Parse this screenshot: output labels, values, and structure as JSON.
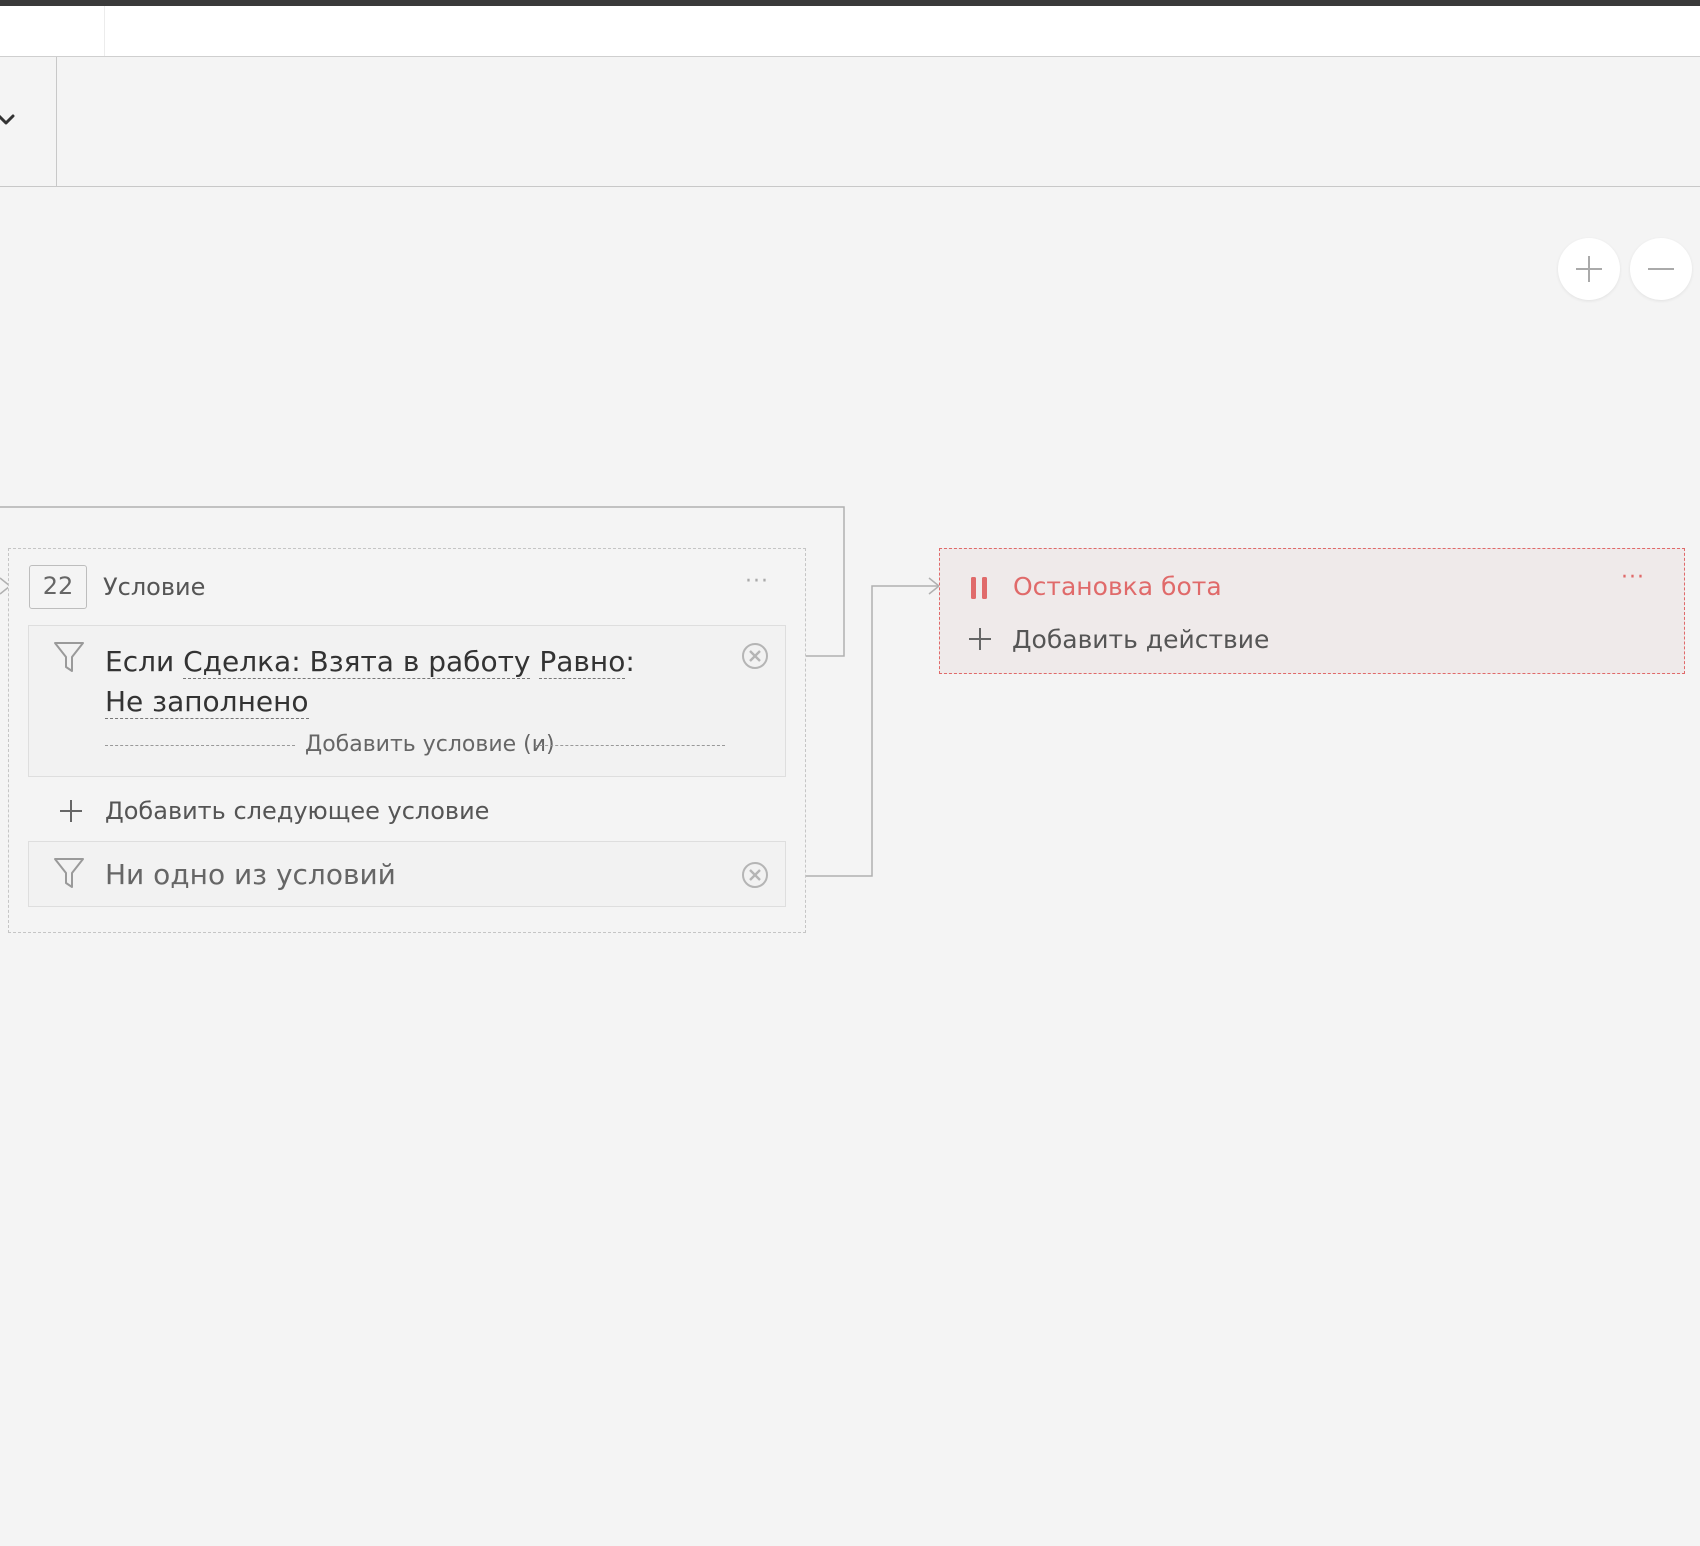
{
  "condition_block": {
    "number": "22",
    "title": "Условие",
    "condition1": {
      "prefix": "Если ",
      "field": "Сделка: Взята в работу",
      "operator": "Равно",
      "colon": ":",
      "value": "Не заполнено",
      "add_and_label": "Добавить условие (и)"
    },
    "add_next_label": "Добавить следующее условие",
    "none_label": "Ни одно из условий"
  },
  "stop_block": {
    "title": "Остановка бота",
    "add_action_label": "Добавить действие"
  },
  "icons": {
    "zoom_in": "plus-icon",
    "zoom_out": "minus-icon",
    "filter": "funnel-icon",
    "remove": "remove-circle-x-icon",
    "pause": "pause-icon",
    "more": "ellipsis-icon",
    "dropdown": "chevron-down-icon"
  },
  "colors": {
    "accent_red": "#e06a6a",
    "canvas_bg": "#f4f4f4"
  }
}
